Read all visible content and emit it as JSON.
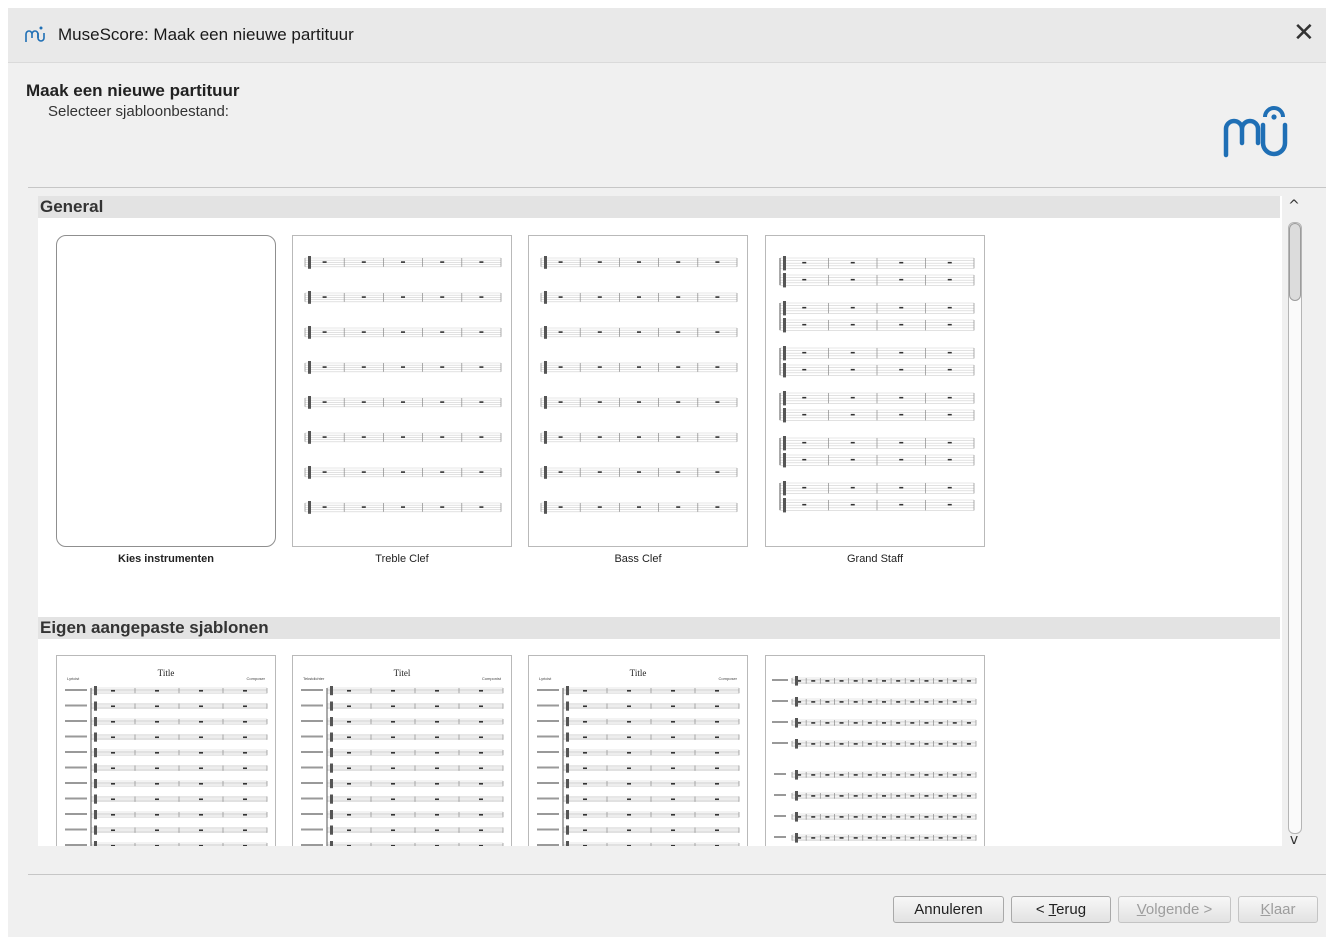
{
  "window": {
    "title": "MuseScore: Maak een nieuwe partituur",
    "close_symbol": "✕"
  },
  "header": {
    "title": "Maak een nieuwe partituur",
    "subtitle": "Selecteer sjabloonbestand:",
    "logo_icon": "musescore-logo-icon"
  },
  "sections": [
    {
      "title": "General",
      "templates": [
        {
          "label": "Kies instrumenten",
          "kind": "blank"
        },
        {
          "label": "Treble Clef",
          "kind": "single-staff"
        },
        {
          "label": "Bass Clef",
          "kind": "single-staff"
        },
        {
          "label": "Grand Staff",
          "kind": "grand-staff"
        }
      ]
    },
    {
      "title": "Eigen aangepaste sjablonen",
      "templates": [
        {
          "thumb_title": "Title",
          "left_heading": "Lyricist",
          "right_heading": "Composer",
          "kind": "orchestra"
        },
        {
          "thumb_title": "Titel",
          "left_heading": "Tekstdichter",
          "right_heading": "Componist",
          "kind": "orchestra"
        },
        {
          "thumb_title": "Title",
          "left_heading": "Lyricist",
          "right_heading": "Composer",
          "kind": "orchestra"
        },
        {
          "kind": "choir"
        }
      ]
    }
  ],
  "scrollbar": {
    "up": "^",
    "down": "v"
  },
  "buttons": {
    "cancel": "Annuleren",
    "back_prefix": "< ",
    "back_mnemonic": "T",
    "back_rest": "erug",
    "next_mnemonic": "V",
    "next_rest": "olgende >",
    "finish_mnemonic": "K",
    "finish_rest": "laar"
  },
  "colors": {
    "window_bg": "#f0f0f0",
    "section_header_bg": "#e3e3e3",
    "logo_blue": "#1f6fb5"
  }
}
